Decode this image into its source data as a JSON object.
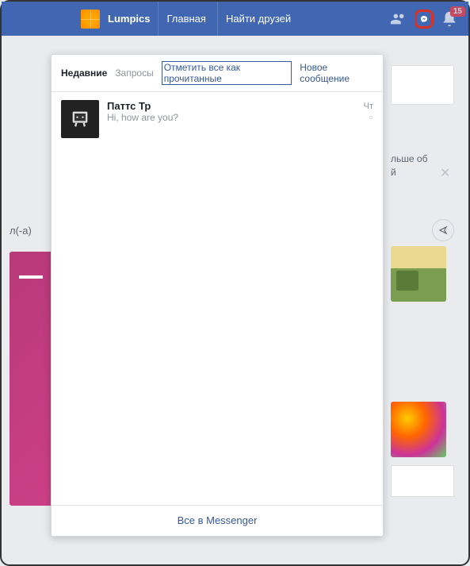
{
  "topbar": {
    "brand": "Lumpics",
    "home": "Главная",
    "find_friends": "Найти друзей",
    "notif_count": "15"
  },
  "dropdown": {
    "recent": "Недавние",
    "requests": "Запросы",
    "mark_read": "Отметить все как прочитанные",
    "new_message": "Новое сообщение",
    "footer": "Все в Messenger"
  },
  "messages": [
    {
      "name": "Паттс Тр",
      "preview": "Hi, how are you?",
      "time": "Чт"
    }
  ],
  "bg": {
    "left_label": "л(-а)",
    "snippet1": "льше об",
    "snippet2": "й"
  }
}
